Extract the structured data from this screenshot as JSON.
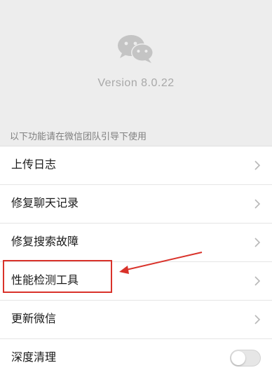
{
  "header": {
    "version_text": "Version 8.0.22",
    "hint_text": "以下功能请在微信团队引导下使用",
    "logo_icon": "wechat-logo-icon"
  },
  "menu": {
    "items": [
      {
        "label": "上传日志",
        "icon": "chevron-right-icon"
      },
      {
        "label": "修复聊天记录",
        "icon": "chevron-right-icon"
      },
      {
        "label": "修复搜索故障",
        "icon": "chevron-right-icon"
      },
      {
        "label": "性能检测工具",
        "icon": "chevron-right-icon",
        "highlighted": true
      },
      {
        "label": "更新微信",
        "icon": "chevron-right-icon"
      },
      {
        "label": "深度清理",
        "control": "toggle",
        "toggle_on": false
      }
    ]
  },
  "annotation": {
    "highlight_color": "#d9322a"
  },
  "colors": {
    "background": "#ededed",
    "row_background": "#ffffff",
    "logo": "#c4c4c4"
  }
}
